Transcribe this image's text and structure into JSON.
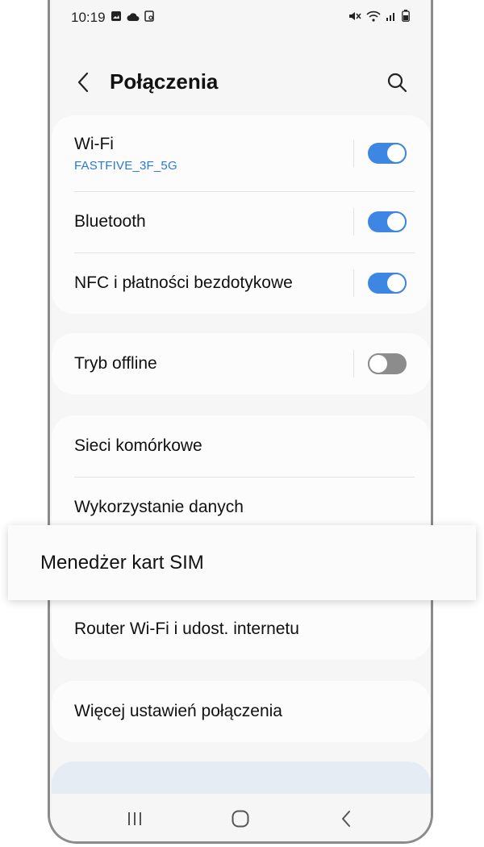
{
  "status_bar": {
    "time": "10:19",
    "left_icons": [
      "gallery-icon",
      "cloud-icon",
      "screenshot-icon"
    ],
    "right_icons": [
      "mute-icon",
      "wifi-icon",
      "signal-icon",
      "battery-icon"
    ]
  },
  "header": {
    "title": "Połączenia",
    "back_icon": "chevron-left-icon",
    "search_icon": "search-icon"
  },
  "groups": [
    {
      "items": [
        {
          "label": "Wi-Fi",
          "subtitle": "FASTFIVE_3F_5G",
          "toggle": true
        },
        {
          "label": "Bluetooth",
          "toggle": true
        },
        {
          "label": "NFC i płatności bezdotykowe",
          "toggle": true
        }
      ]
    },
    {
      "items": [
        {
          "label": "Tryb offline",
          "toggle": false
        }
      ]
    },
    {
      "items": [
        {
          "label": "Sieci komórkowe"
        },
        {
          "label": "Wykorzystanie danych"
        },
        {
          "label": "Router Wi-Fi i udost. internetu"
        }
      ]
    },
    {
      "items": [
        {
          "label": "Więcej ustawień połączenia"
        }
      ]
    }
  ],
  "highlight": {
    "label": "Menedżer kart SIM"
  },
  "navbar": {
    "recents_icon": "recents-icon",
    "home_icon": "home-icon",
    "back_icon": "back-icon"
  },
  "colors": {
    "accent": "#3e86e4",
    "subtitle": "#2979d6",
    "toggle_off": "#8c8c8c",
    "background": "#f6f6f6",
    "card": "#fcfcfc"
  }
}
